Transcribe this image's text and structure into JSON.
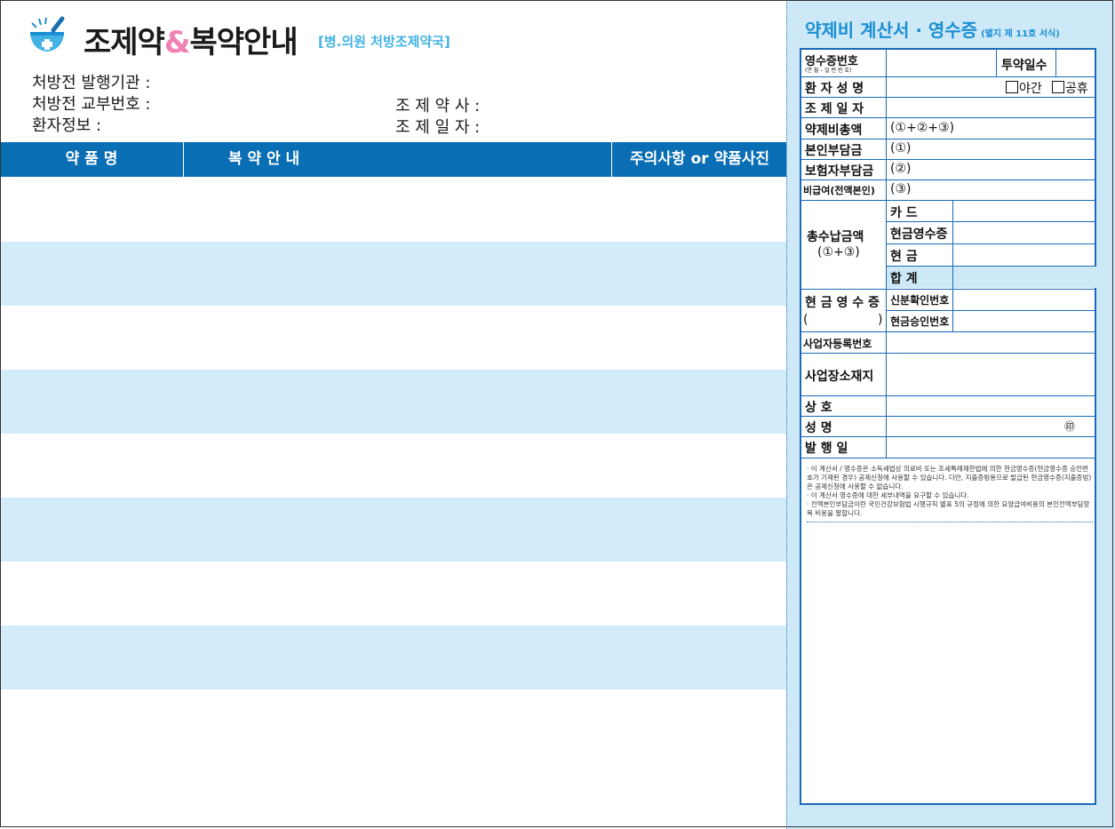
{
  "header": {
    "title_part1": "조제약",
    "title_amp": "&",
    "title_part2": "복약안내",
    "subtitle": "[병.의원 처방조제약국]"
  },
  "info": {
    "issuer_label": "처방전 발행기관 :",
    "issue_no_label": "처방전 교부번호 :",
    "patient_label": "환자정보 :",
    "pharmacist_label": "조 제 약 사 :",
    "dispense_date_label": "조 제 일 자 :"
  },
  "table": {
    "columns": [
      "약 품 명",
      "복 약 안 내",
      "주의사항 or 약품사진"
    ],
    "row_count": 8
  },
  "receipt": {
    "title": "약제비 계산서 · 영수증",
    "form_no": "(별지 제 11호 서식)",
    "receipt_no": "영수증번호",
    "receipt_no_sub": "(연 월 – 일 련 번 호)",
    "days": "투약일수",
    "patient_name": "환 자 성 명",
    "night": "야간",
    "holiday": "공휴",
    "dispense_date": "조 제 일 자",
    "total_cost": "약제비총액",
    "total_cost_formula": "(①+②+③)",
    "self_pay": "본인부담금",
    "self_pay_mark": "(①)",
    "insurer_pay": "보험자부담금",
    "insurer_mark": "(②)",
    "non_covered": "비급여(전액본인)",
    "non_covered_mark": "(③)",
    "total_paid": "총수납금액",
    "total_paid_formula": "(①+③)",
    "card": "카        드",
    "cash_receipt": "현금영수증",
    "cash": "현        금",
    "sum": "합        계",
    "cash_receipt_block": "현 금 영 수 증",
    "paren_open": "(",
    "paren_close": ")",
    "id_check": "신분확인번호",
    "approval_no": "현금승인번호",
    "biz_reg_no": "사업자등록번호",
    "biz_address": "사업장소재지",
    "shop_name": "상          호",
    "name": "성          명",
    "seal": "㊞",
    "issue_date": "발    행    일",
    "notes": [
      "· 이 계산서 / 영수증은 소득세법상 의료비 또는 조세특례제한법에 의한 현금영수증(현금영수증 승인번호가 기재된 경우) 공제신청에 사용할 수 있습니다. 다만, 지출증빙용으로 발급된 현금영수증(지출증빙)은 공제신청에 사용할 수 없습니다.",
      "· 이 계산서 영수증에 대한 세부내역을 요구할 수 있습니다.",
      "· 전액본인부담금이란 국민건강보험법 시행규칙 별표 5의 규정에 의한 요양급여비용의 본인전액부담항목 비용을 말합니다."
    ]
  },
  "colors": {
    "header_blue": "#0a6eb4",
    "row_shade": "#d3ecfa",
    "accent_pink": "#f083b4",
    "accent_cyan": "#43b3e6"
  }
}
